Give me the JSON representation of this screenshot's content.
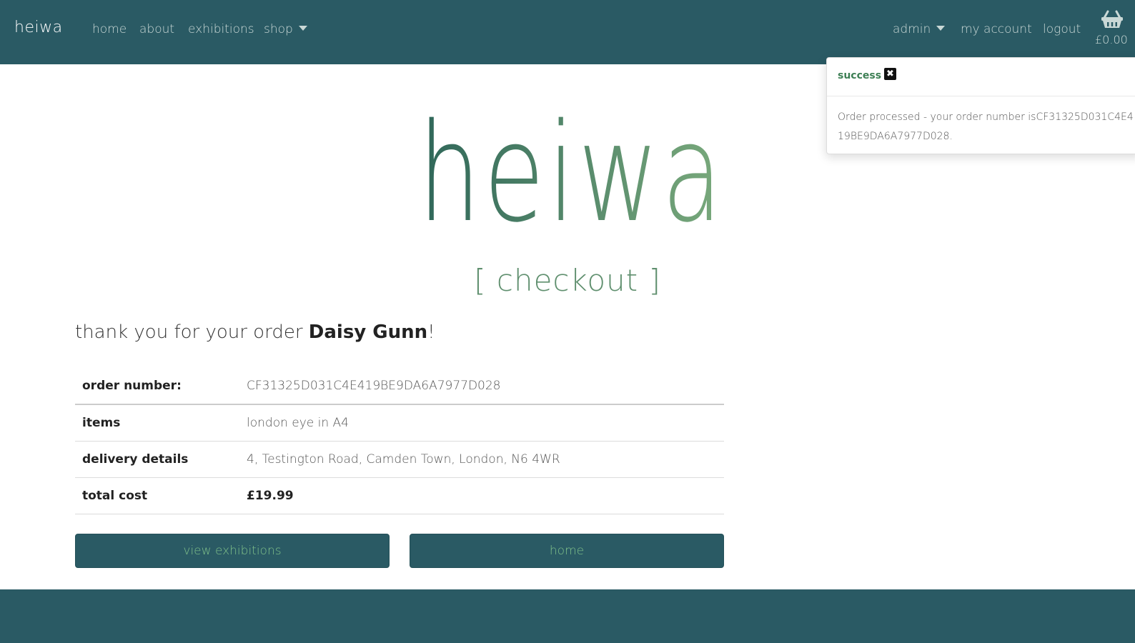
{
  "navbar": {
    "brand": "heiwa",
    "links": {
      "home": "home",
      "about": "about",
      "exhibitions": "exhibitions",
      "shop": "shop"
    },
    "right": {
      "admin": "admin",
      "my_account": "my account",
      "logout": "logout"
    },
    "basket_total": "£0.00",
    "basket_icon": "basket-icon"
  },
  "toast": {
    "title": "success",
    "close_icon": "close-icon",
    "message": "Order processed - your order number isCF31325D031C4E419BE9DA6A7977D028."
  },
  "hero": {
    "logo_text": "heiwa",
    "subtitle": "[ checkout ]"
  },
  "thanks": {
    "prefix": "thank you for your order ",
    "customer_name": "Daisy Gunn",
    "suffix": "!"
  },
  "order": {
    "rows": [
      {
        "label": "order number:",
        "value": "CF31325D031C4E419BE9DA6A7977D028"
      },
      {
        "label": "items",
        "value": "london eye in A4"
      },
      {
        "label": "delivery details",
        "value": "4, Testington Road, Camden Town, London, N6 4WR"
      },
      {
        "label": "total cost",
        "value": "£19.99"
      }
    ]
  },
  "buttons": {
    "view_exhibitions": "view exhibitions",
    "home": "home"
  },
  "colors": {
    "navbar_bg": "#2a5a64",
    "accent_green": "#7fc08a",
    "logo_dark": "#2f6659",
    "logo_light": "#7aaa7c"
  }
}
